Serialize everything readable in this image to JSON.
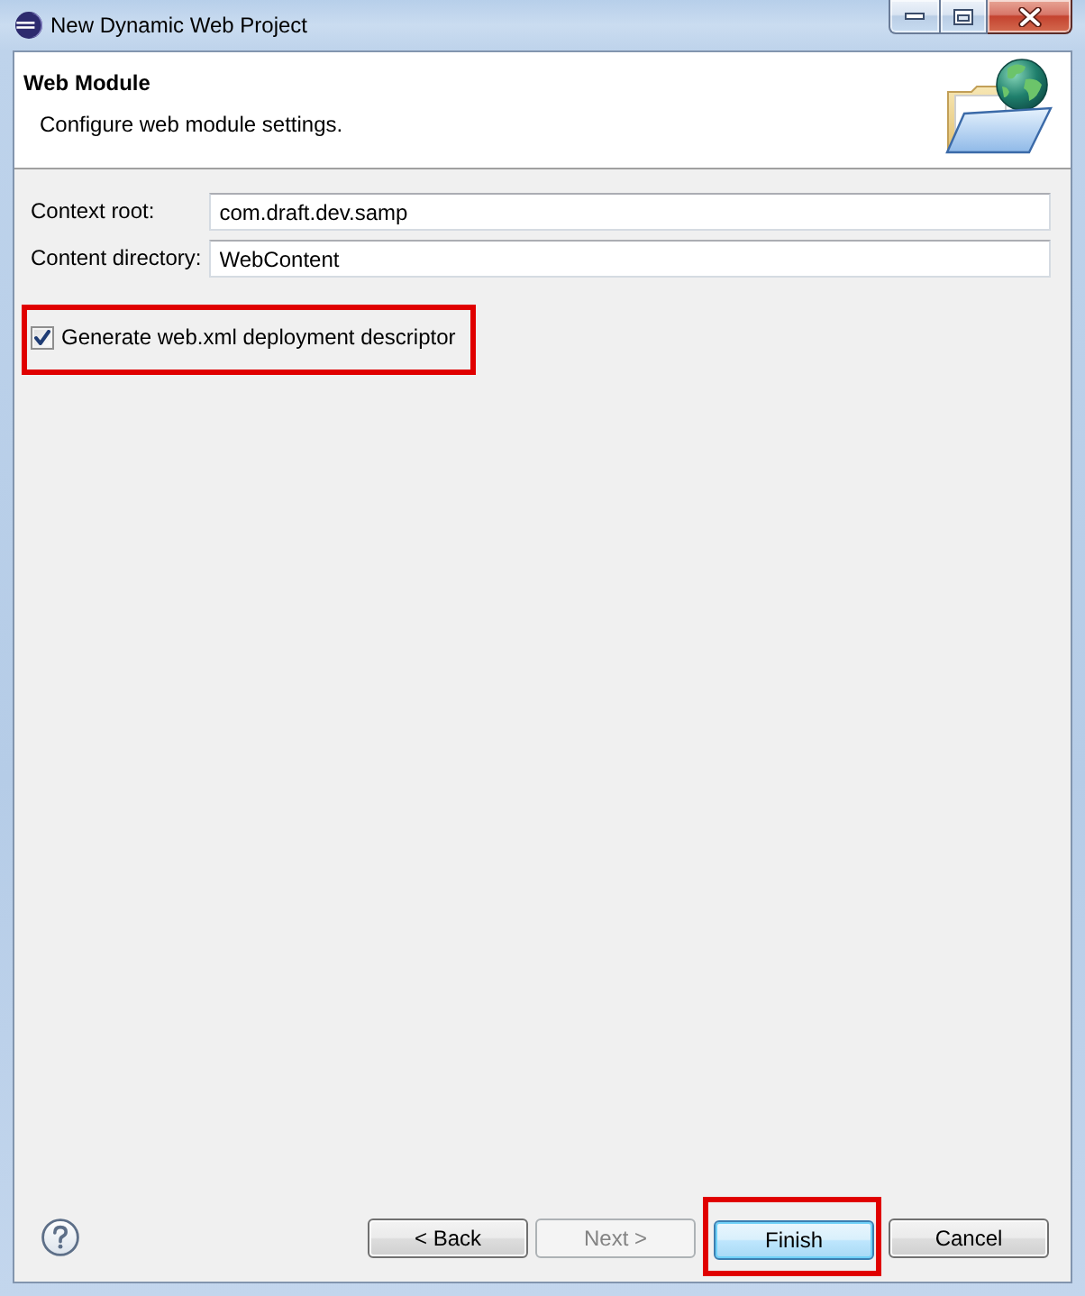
{
  "window": {
    "title": "New Dynamic Web Project"
  },
  "header": {
    "title": "Web Module",
    "description": "Configure web module settings."
  },
  "fields": [
    {
      "label": "Context root:",
      "value": "com.draft.dev.samp"
    },
    {
      "label": "Content directory:",
      "value": "WebContent"
    }
  ],
  "options": [
    {
      "label": "Generate web.xml deployment descriptor",
      "checked": true,
      "highlighted": true
    }
  ],
  "buttons": [
    {
      "label": "< Back",
      "disabled": false,
      "default": false,
      "highlighted": false
    },
    {
      "label": "Next >",
      "disabled": true,
      "default": false,
      "highlighted": false
    },
    {
      "label": "Finish",
      "disabled": false,
      "default": true,
      "highlighted": true
    },
    {
      "label": "Cancel",
      "disabled": false,
      "default": false,
      "highlighted": false
    }
  ]
}
